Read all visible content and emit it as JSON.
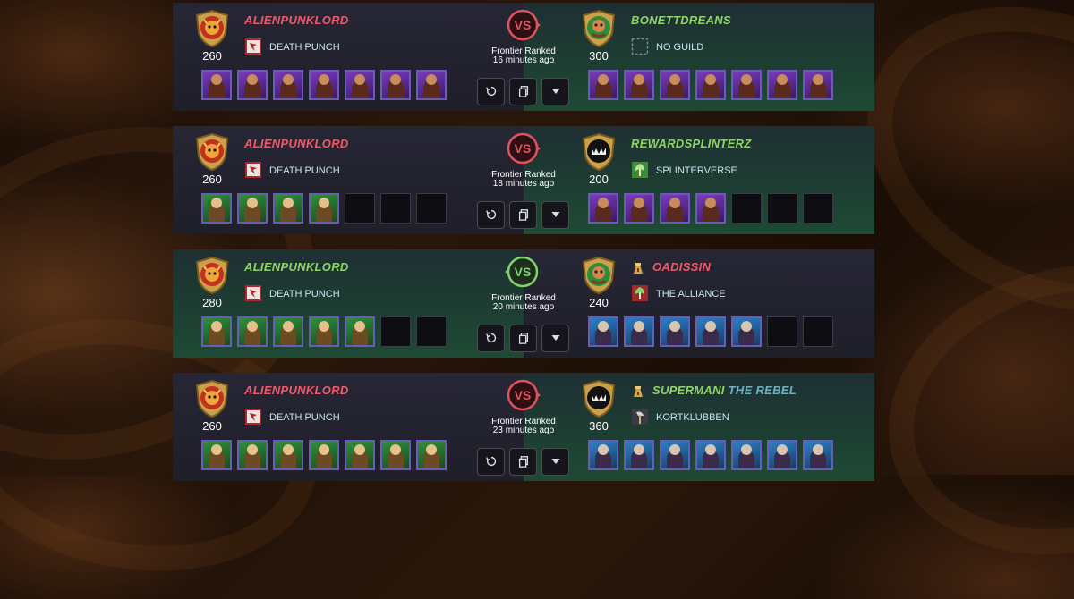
{
  "battles": [
    {
      "player": {
        "name": "ALIENPUNKLORD",
        "rating": "260",
        "guild": "DEATH PUNCH",
        "result": "lose"
      },
      "opponent": {
        "name": "BONETTDREANS",
        "rating": "300",
        "guild": "NO GUILD",
        "result": "win",
        "avatar": "green",
        "guild_icon": "empty"
      },
      "mode": "Frontier Ranked",
      "time": "16 minutes ago",
      "vs_state": "lose",
      "player_cards": [
        "purple",
        "purple",
        "purple",
        "purple",
        "purple",
        "purple",
        "purple"
      ],
      "opponent_cards": [
        "purple",
        "purple",
        "purple",
        "purple",
        "purple",
        "purple",
        "purple"
      ]
    },
    {
      "player": {
        "name": "ALIENPUNKLORD",
        "rating": "260",
        "guild": "DEATH PUNCH",
        "result": "lose"
      },
      "opponent": {
        "name": "REWARDSPLINTERZ",
        "rating": "200",
        "guild": "SPLINTERVERSE",
        "result": "win",
        "avatar": "dark",
        "guild_icon": "tree"
      },
      "mode": "Frontier Ranked",
      "time": "18 minutes ago",
      "vs_state": "lose",
      "player_cards": [
        "green",
        "green",
        "green",
        "green",
        "empty",
        "empty",
        "empty"
      ],
      "opponent_cards": [
        "purple",
        "purple",
        "purple",
        "purple",
        "empty",
        "empty",
        "empty"
      ]
    },
    {
      "player": {
        "name": "ALIENPUNKLORD",
        "rating": "280",
        "guild": "DEATH PUNCH",
        "result": "win"
      },
      "opponent": {
        "name": "OADISSIN",
        "rating": "240",
        "guild": "THE ALLIANCE",
        "result": "lose",
        "avatar": "green",
        "guild_icon": "tree-red",
        "title_icon": true
      },
      "mode": "Frontier Ranked",
      "time": "20 minutes ago",
      "vs_state": "win",
      "player_cards": [
        "green",
        "green",
        "green",
        "green",
        "green",
        "empty",
        "empty"
      ],
      "opponent_cards": [
        "blue",
        "blue",
        "blue",
        "blue",
        "blue",
        "empty",
        "empty"
      ]
    },
    {
      "player": {
        "name": "ALIENPUNKLORD",
        "rating": "260",
        "guild": "DEATH PUNCH",
        "result": "lose"
      },
      "opponent": {
        "name": "SUPERMANI",
        "name_ext": "THE REBEL",
        "rating": "360",
        "guild": "KORTKLUBBEN",
        "result": "win",
        "avatar": "dark",
        "guild_icon": "axe",
        "title_icon": true
      },
      "mode": "Frontier Ranked",
      "time": "23 minutes ago",
      "vs_state": "lose",
      "player_cards": [
        "green",
        "green",
        "green",
        "green",
        "green",
        "green",
        "green"
      ],
      "opponent_cards": [
        "blue",
        "blue",
        "blue",
        "blue",
        "blue",
        "blue",
        "blue"
      ]
    }
  ],
  "vs_label": "VS",
  "colors": {
    "accent_red": "#ef5a6b",
    "accent_green": "#8fd56a",
    "guild_text": "#c7e6ee"
  },
  "icons": {
    "replay": "replay-icon",
    "copy": "copy-icon",
    "expand": "chevron-down-icon"
  }
}
